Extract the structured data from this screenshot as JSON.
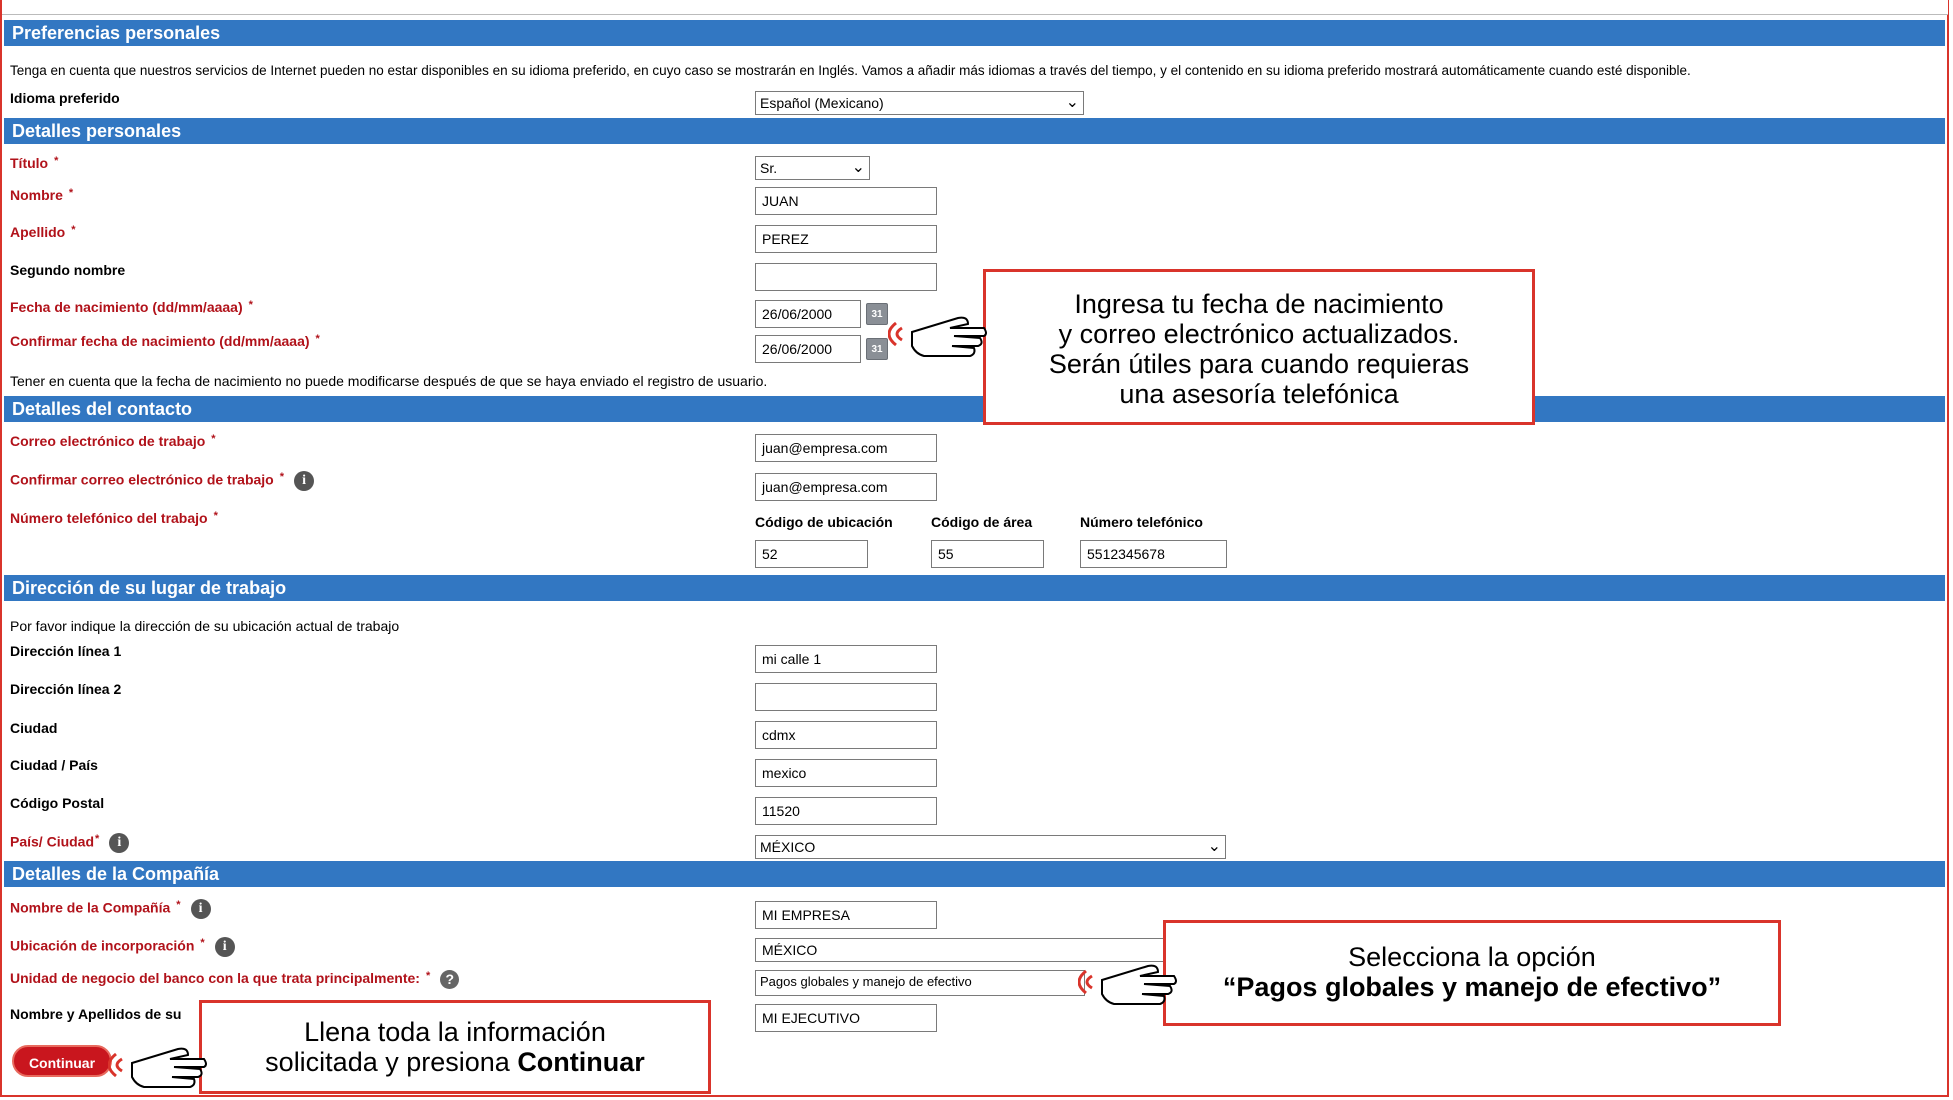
{
  "sections": {
    "preferences": "Preferencias personales",
    "personal": "Detalles personales",
    "contact": "Detalles del contacto",
    "address": "Dirección de su lugar de trabajo",
    "company": "Detalles de la Compañía"
  },
  "preferences": {
    "note": "Tenga en cuenta que nuestros servicios de Internet pueden no estar disponibles en su idioma preferido, en cuyo caso se mostrarán en Inglés. Vamos a añadir más idiomas a través del tiempo, y el contenido en su idioma preferido mostrará automáticamente cuando esté disponible.",
    "language_label": "Idioma preferido",
    "language_value": "Español (Mexicano)"
  },
  "personal": {
    "title_label": "Título",
    "title_value": "Sr.",
    "first_name_label": "Nombre",
    "first_name_value": "JUAN",
    "last_name_label": "Apellido",
    "last_name_value": "PEREZ",
    "middle_name_label": "Segundo nombre",
    "middle_name_value": "",
    "dob_label": "Fecha de nacimiento (dd/mm/aaaa)",
    "dob_value": "26/06/2000",
    "dob_confirm_label": "Confirmar fecha de nacimiento (dd/mm/aaaa)",
    "dob_confirm_value": "26/06/2000",
    "dob_note": "Tener en cuenta que la fecha de nacimiento no puede modificarse después de que se haya enviado el registro de usuario."
  },
  "contact": {
    "email_label": "Correo electrónico de trabajo",
    "email_value": "juan@empresa.com",
    "email_confirm_label": "Confirmar correo electrónico de trabajo",
    "email_confirm_value": "juan@empresa.com",
    "phone_label": "Número telefónico del trabajo",
    "location_code_label": "Código de ubicación",
    "location_code_value": "52",
    "area_code_label": "Código de área",
    "area_code_value": "55",
    "phone_number_label": "Número telefónico",
    "phone_number_value": "5512345678"
  },
  "address": {
    "note": "Por favor indique la dirección de su ubicación actual de trabajo",
    "line1_label": "Dirección línea 1",
    "line1_value": "mi calle 1",
    "line2_label": "Dirección línea 2",
    "line2_value": "",
    "city_label": "Ciudad",
    "city_value": "cdmx",
    "state_label": "Ciudad / País",
    "state_value": "mexico",
    "zip_label": "Código Postal",
    "zip_value": "11520",
    "country_label": "País/ Ciudad",
    "country_value": "MÉXICO"
  },
  "company": {
    "name_label": "Nombre de la Compañía",
    "name_value": "MI EMPRESA",
    "incorporation_label": "Ubicación de incorporación",
    "incorporation_value": "MÉXICO",
    "business_unit_label": "Unidad de negocio del banco con la que trata principalmente:",
    "business_unit_value": "Pagos globales y manejo de efectivo",
    "exec_label": "Nombre y Apellidos de su",
    "exec_value": "MI EJECUTIVO"
  },
  "required_mark": "*",
  "continue_label": "Continuar",
  "callouts": {
    "dob_email": {
      "line1": "Ingresa tu fecha de nacimiento",
      "line2": "y correo electrónico actualizados.",
      "line3": "Serán útiles para cuando requieras",
      "line4": "una asesoría telefónica"
    },
    "business_unit": {
      "line1": "Selecciona la opción",
      "line2": "“Pagos globales y manejo de efectivo”"
    },
    "continue": {
      "line1": "Llena toda la información",
      "line2_prefix": "solicitada y presiona ",
      "line2_bold": "Continuar"
    }
  },
  "colors": {
    "section_bar": "#3277c2",
    "required_label": "#b1121a",
    "callout_border": "#d9342b",
    "continue_button": "#c9161e"
  },
  "icons": [
    "info-icon",
    "help-icon",
    "calendar-icon",
    "chevron-down-icon",
    "pointing-hand-icon"
  ]
}
